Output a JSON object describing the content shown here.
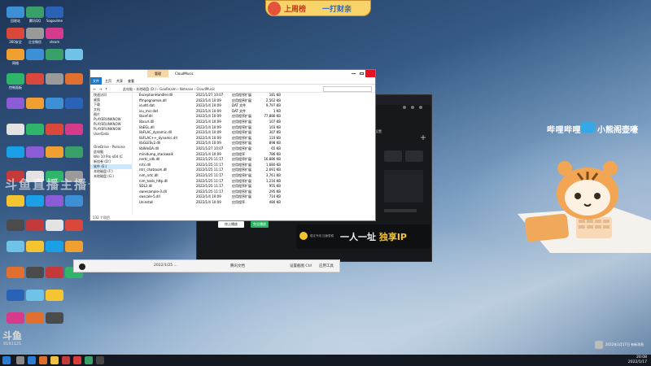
{
  "top_banner": {
    "left": "上周榜",
    "right": "一打财亲"
  },
  "desktop_icons_col1": [
    "回收站",
    "360安全",
    "网络",
    "控制面板",
    "",
    "",
    "",
    "",
    "",
    "",
    "",
    "",
    "",
    "",
    "",
    ""
  ],
  "desktop_icons_col2": [
    "腾讯QQ",
    "企业微信",
    "",
    "",
    "",
    "",
    "",
    "",
    "",
    "",
    "",
    "",
    "",
    "",
    ""
  ],
  "desktop_icons_col3": [
    "SogouIme",
    "steam",
    "",
    "",
    "",
    "",
    "",
    "",
    "",
    "",
    "",
    "",
    "",
    "",
    ""
  ],
  "explorer": {
    "title": "CloudMusic",
    "ribbon_tabs": [
      "文件",
      "主页",
      "共享",
      "查看"
    ],
    "manage_tab": "管理",
    "path": [
      "此电脑",
      "本地磁盘 (D:)",
      "GooRealm",
      "Netease",
      "CloudMusic"
    ],
    "nav_items": [
      "快速访问",
      "桌面",
      "下载",
      "文档",
      "图片",
      "PLAYERUNKNOW",
      "PLAYERUNKNOW",
      "PLAYERUNKNOW",
      "UserData",
      "OneDrive - Persona",
      "此电脑",
      "Win 10 Pro x64 (C",
      "新加卷 (D:)",
      "软件 (E:)",
      "本地磁盘 (F:)",
      "本地磁盘 (G:)"
    ],
    "files": [
      [
        "ExceptionHandler.dll",
        "2021/1/27 10:07",
        "应用程序扩展",
        "181 KB"
      ],
      [
        "ffmpegnames.dll",
        "2022/1/4 10:09",
        "应用程序扩展",
        "2,562 KB"
      ],
      [
        "icudtl.dat",
        "2022/1/4 10:09",
        "DAT 文件",
        "9,797 KB"
      ],
      [
        "icu_mcr.dat",
        "2022/1/4 10:09",
        "DAT 文件",
        "1 KB"
      ],
      [
        "libcef.dll",
        "2022/1/4 10:09",
        "应用程序扩展",
        "77,886 KB"
      ],
      [
        "libcurl.dll",
        "2022/1/4 10:09",
        "应用程序扩展",
        "107 KB"
      ],
      [
        "libEGL.dll",
        "2022/1/4 10:09",
        "应用程序扩展",
        "103 KB"
      ],
      [
        "libFLAC_dynamic.dll",
        "2022/1/4 10:09",
        "应用程序扩展",
        "307 KB"
      ],
      [
        "libFLAC++_dynamic.dll",
        "2022/1/4 10:09",
        "应用程序扩展",
        "110 KB"
      ],
      [
        "libGLESv2.dll",
        "2022/1/4 10:09",
        "应用程序扩展",
        "898 KB"
      ],
      [
        "libWinDA.dll",
        "2021/1/27 10:07",
        "应用程序扩展",
        "65 KB"
      ],
      [
        "minidump_stackwalk",
        "2022/1/4 10:09",
        "应用程序",
        "786 KB"
      ],
      [
        "nertc_sdk.dll",
        "2022/1/25 11:17",
        "应用程序扩展",
        "16,886 KB"
      ],
      [
        "nrtc.dll",
        "2022/1/25 11:17",
        "应用程序扩展",
        "1,680 KB"
      ],
      [
        "ntrr_chatroom.dll",
        "2022/1/25 11:17",
        "应用程序扩展",
        "2,691 KB"
      ],
      [
        "nim_nrtc.dll",
        "2022/1/25 11:17",
        "应用程序扩展",
        "3,761 KB"
      ],
      [
        "nim_tools_http.dll",
        "2022/1/25 11:17",
        "应用程序扩展",
        "1,216 KB"
      ],
      [
        "SDL2.dll",
        "2022/1/25 11:17",
        "应用程序扩展",
        "955 KB"
      ],
      [
        "swresample-3.dll",
        "2022/1/25 11:17",
        "应用程序扩展",
        "295 KB"
      ],
      [
        "swscale-5.dll",
        "2022/1/4 10:09",
        "应用程序扩展",
        "714 KB"
      ],
      [
        "Uninstall",
        "2022/1/4 10:09",
        "应用程序",
        "480 KB"
      ]
    ],
    "status": "132 个项目"
  },
  "dark_app": {
    "title": "云音乐 - 播放设置",
    "btn_white": "终止播放",
    "btn_green": "完全播放"
  },
  "ad_banner": {
    "a": "一人一址",
    "b": "独享IP",
    "small": "稳定专线 加速更稳"
  },
  "bili": {
    "left": "哔哩哔哩",
    "right": "小熊阁壶嚎"
  },
  "watermark": "斗鱼直播主播号",
  "qq_bar": {
    "left": "2022/1/25 ...",
    "mid": "腾讯文档",
    "a": "设置截图 Ctrl",
    "b": "定时 ...",
    "c": "应用工具"
  },
  "douyu": {
    "logo": "斗鱼",
    "room": "9191121"
  },
  "clock": {
    "time": "20:08",
    "date": "2022/1/17"
  },
  "notif": "2022年1月17日 有新消息"
}
